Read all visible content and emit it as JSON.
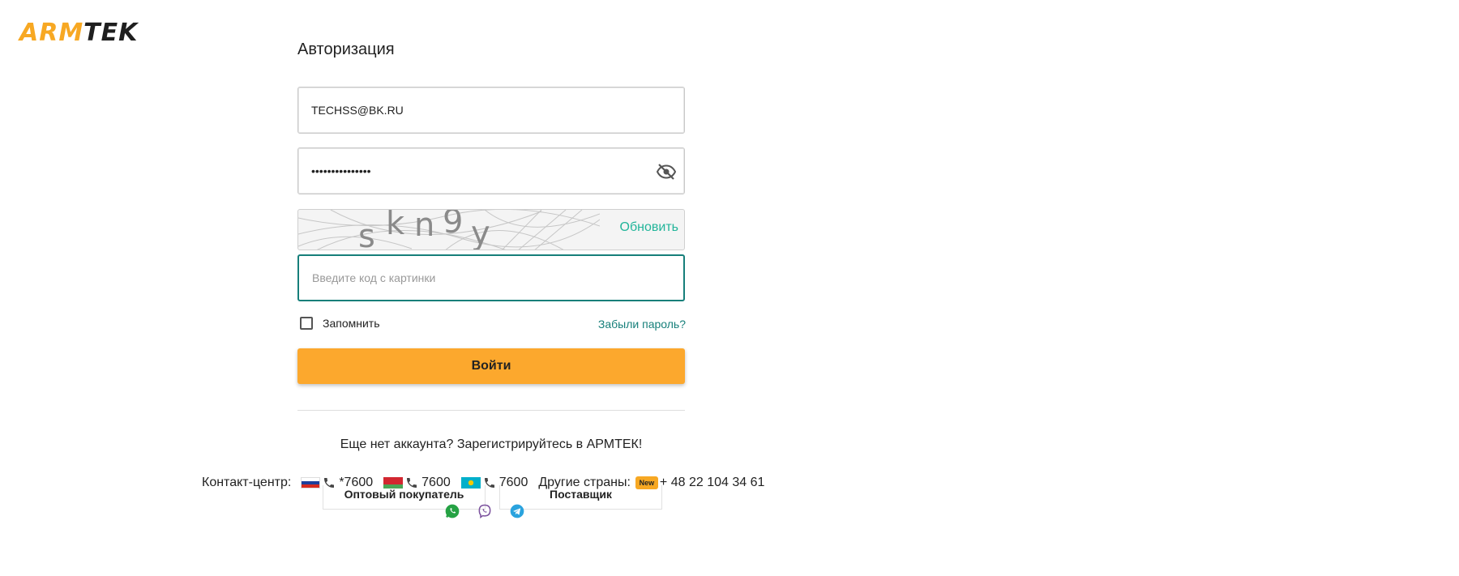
{
  "logo": {
    "part1": "ARM",
    "part2": "TEK",
    "accent_color": "#f7a823"
  },
  "form": {
    "title": "Авторизация",
    "login_value": "TECHSS@BK.RU",
    "password_value": "•••••••••••••••",
    "captcha": {
      "text": "skn9y",
      "refresh_label": "Обновить"
    },
    "captcha_input_placeholder": "Введите код с картинки",
    "remember_label": "Запомнить",
    "forgot_label": "Забыли пароль?",
    "login_button": "Войти",
    "register_text": "Еще нет аккаунта? Зарегистрируйтесь в АРМТЕК!"
  },
  "contacts": {
    "label": "Контакт-центр:",
    "phones": [
      "*7600",
      "7600",
      "7600"
    ],
    "other_label": "Другие страны:",
    "new_badge": "New",
    "other_phone": "+ 48 22 104 34 61"
  },
  "tabs": [
    "Оптовый покупатель",
    "Поставщик"
  ],
  "colors": {
    "primary_button": "#fca82d",
    "link": "#167f7a",
    "refresh": "#22b59a"
  }
}
